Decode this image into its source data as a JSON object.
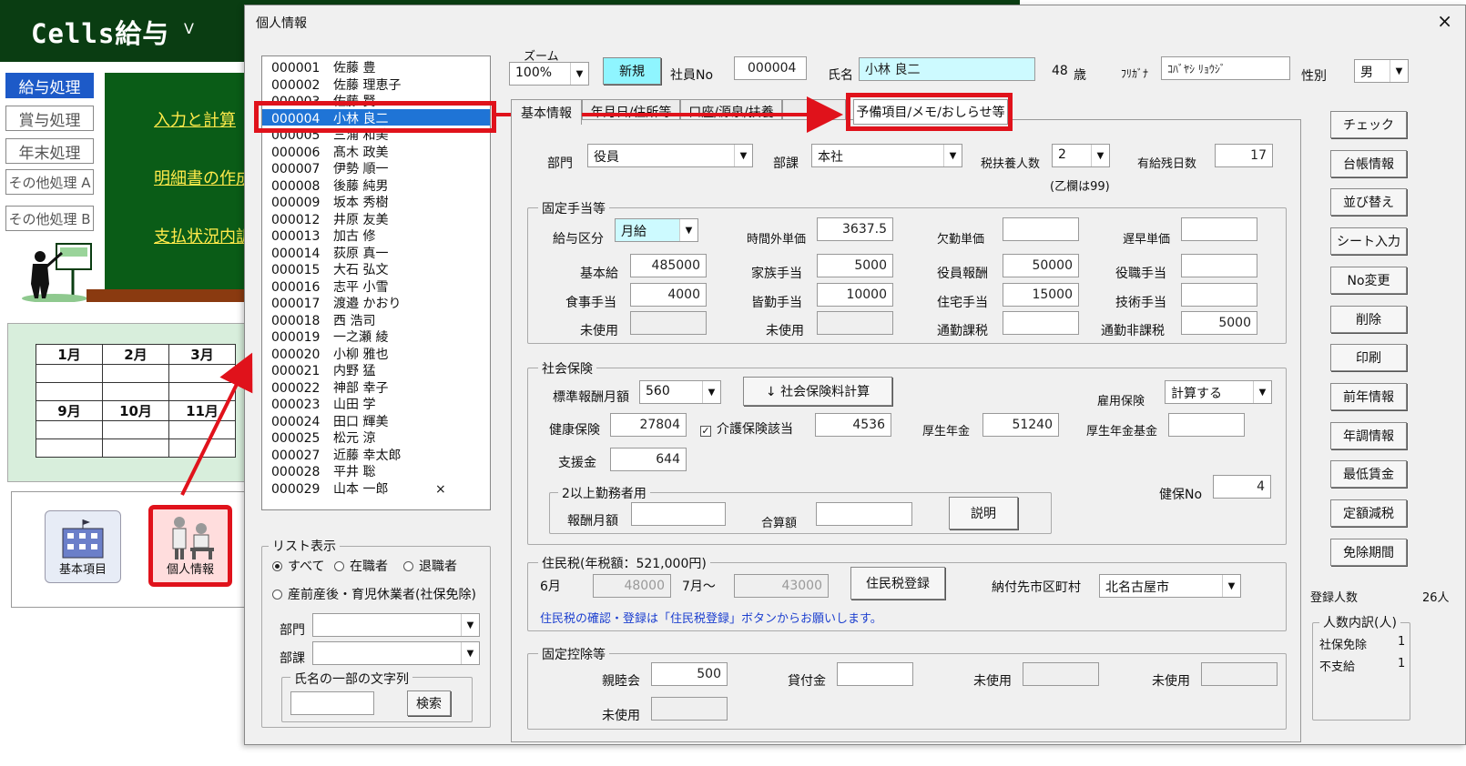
{
  "app": {
    "title": "Cells給与",
    "version": "V"
  },
  "left_menu": [
    "給与処理",
    "賞与処理",
    "年末処理",
    "その他処理 A",
    "その他処理 B"
  ],
  "green_links": [
    "入力と計算",
    "明細書の作成",
    "支払状況内訳"
  ],
  "calendar": {
    "row1": [
      "1月",
      "2月",
      "3月"
    ],
    "row2": [
      "9月",
      "10月",
      "11月"
    ]
  },
  "tray": {
    "basic": "基本項目",
    "personal": "個人情報"
  },
  "window": {
    "title": "個人情報",
    "close": "×"
  },
  "employees": [
    {
      "no": "000001",
      "name": "佐藤 豊"
    },
    {
      "no": "000002",
      "name": "佐藤 理恵子"
    },
    {
      "no": "000003",
      "name": "佐藤 賢"
    },
    {
      "no": "000004",
      "name": "小林 良二"
    },
    {
      "no": "000005",
      "name": "三浦 和美"
    },
    {
      "no": "000006",
      "name": "髙木 政美"
    },
    {
      "no": "000007",
      "name": "伊勢 順一"
    },
    {
      "no": "000008",
      "name": "後藤 純男"
    },
    {
      "no": "000009",
      "name": "坂本 秀樹"
    },
    {
      "no": "000012",
      "name": "井原 友美"
    },
    {
      "no": "000013",
      "name": "加古 修"
    },
    {
      "no": "000014",
      "name": "荻原 真一"
    },
    {
      "no": "000015",
      "name": "大石 弘文"
    },
    {
      "no": "000016",
      "name": "志平 小雪"
    },
    {
      "no": "000017",
      "name": "渡邉 かおり"
    },
    {
      "no": "000018",
      "name": "西 浩司"
    },
    {
      "no": "000019",
      "name": "一之瀬 綾"
    },
    {
      "no": "000020",
      "name": "小柳 雅也"
    },
    {
      "no": "000021",
      "name": "内野 猛"
    },
    {
      "no": "000022",
      "name": "神部 幸子"
    },
    {
      "no": "000023",
      "name": "山田 学"
    },
    {
      "no": "000024",
      "name": "田口 輝美"
    },
    {
      "no": "000025",
      "name": "松元 涼"
    },
    {
      "no": "000027",
      "name": "近藤 幸太郎"
    },
    {
      "no": "000028",
      "name": "平井 聡"
    },
    {
      "no": "000029",
      "name": "山本 一郎",
      "mark": "×"
    }
  ],
  "list_filter": {
    "title": "リスト表示",
    "all": "すべて",
    "active": "在職者",
    "retired": "退職者",
    "leave": "産前産後・育児休業者(社保免除)",
    "dept_label": "部門",
    "section_label": "部課",
    "name_search_title": "氏名の一部の文字列",
    "search_btn": "検索"
  },
  "header": {
    "zoom_label": "ズーム",
    "zoom": "100%",
    "new_btn": "新規",
    "empno_label": "社員No",
    "empno": "000004",
    "name_label": "氏名",
    "name": "小林 良二",
    "age": "48",
    "age_unit": "歳",
    "kana_label": "ﾌﾘｶﾞﾅ",
    "kana": "ｺﾊﾞﾔｼ ﾘｮｳｼﾞ",
    "gender_label": "性別",
    "gender": "男"
  },
  "tabs": [
    "基本情報",
    "年月日/住所等",
    "口座/源泉/扶養",
    "",
    "予備項目/メモ/おしらせ等"
  ],
  "basic": {
    "dept_label": "部門",
    "dept": "役員",
    "section_label": "部課",
    "section": "本社",
    "dependents_label": "税扶養人数",
    "dependents": "2",
    "dependents_note": "(乙欄は99)",
    "paid_leave_label": "有給残日数",
    "paid_leave": "17"
  },
  "allowances": {
    "title": "固定手当等",
    "pay_type_label": "給与区分",
    "pay_type": "月給",
    "ot_rate_label": "時間外単価",
    "ot_rate": "3637.5",
    "absence_label": "欠勤単価",
    "absence": "",
    "late_label": "遅早単価",
    "late": "",
    "base_label": "基本給",
    "base": "485000",
    "family_label": "家族手当",
    "family": "5000",
    "director_label": "役員報酬",
    "director": "50000",
    "position_label": "役職手当",
    "position": "",
    "meal_label": "食事手当",
    "meal": "4000",
    "attendance_label": "皆勤手当",
    "attendance": "10000",
    "housing_label": "住宅手当",
    "housing": "15000",
    "skill_label": "技術手当",
    "skill": "",
    "unused1_label": "未使用",
    "unused2_label": "未使用",
    "commute_tax_label": "通勤課税",
    "commute_tax": "",
    "commute_nontax_label": "通勤非課税",
    "commute_nontax": "5000"
  },
  "social": {
    "title": "社会保険",
    "std_label": "標準報酬月額",
    "std": "560",
    "calc_btn": "↓ 社会保険料計算",
    "emp_ins_label": "雇用保険",
    "emp_ins": "計算する",
    "health_label": "健康保険",
    "health": "27804",
    "care_label": "介護保険該当",
    "care": "4536",
    "pension_label": "厚生年金",
    "pension": "51240",
    "pension_fund_label": "厚生年金基金",
    "pension_fund": "",
    "support_label": "支援金",
    "support": "644",
    "multi_title": "2以上勤務者用",
    "multi_pay_label": "報酬月額",
    "multi_pay": "",
    "sum_label": "合算額",
    "sum": "",
    "explain_btn": "説明",
    "kenpo_label": "健保No",
    "kenpo": "4"
  },
  "resident": {
    "title": "住民税(年税額：521,000円)",
    "june_label": "6月",
    "june": "48000",
    "july_label": "7月～",
    "july": "43000",
    "register_btn": "住民税登録",
    "city_label": "納付先市区町村",
    "city": "北名古屋市",
    "note": "住民税の確認・登録は「住民税登録」ボタンからお願いします。"
  },
  "deductions": {
    "title": "固定控除等",
    "club_label": "親睦会",
    "club": "500",
    "loan_label": "貸付金",
    "loan": "",
    "unused_a_label": "未使用",
    "unused_b_label": "未使用",
    "unused_c_label": "未使用"
  },
  "side_buttons": [
    "チェック",
    "台帳情報",
    "並び替え",
    "シート入力",
    "No変更",
    "削除",
    "印刷",
    "前年情報",
    "年調情報",
    "最低賃金",
    "定額減税",
    "免除期間"
  ],
  "stats": {
    "count_label": "登録人数",
    "count": "26人",
    "breakdown_title": "人数内訳(人)",
    "exempt_label": "社保免除",
    "exempt": "1",
    "unpaid_label": "不支給",
    "unpaid": "1"
  },
  "colors": {
    "accent_red": "#e0121b",
    "selection_blue": "#1f74d6",
    "app_green": "#0a3d12",
    "cyan_field": "#cdfaff"
  }
}
